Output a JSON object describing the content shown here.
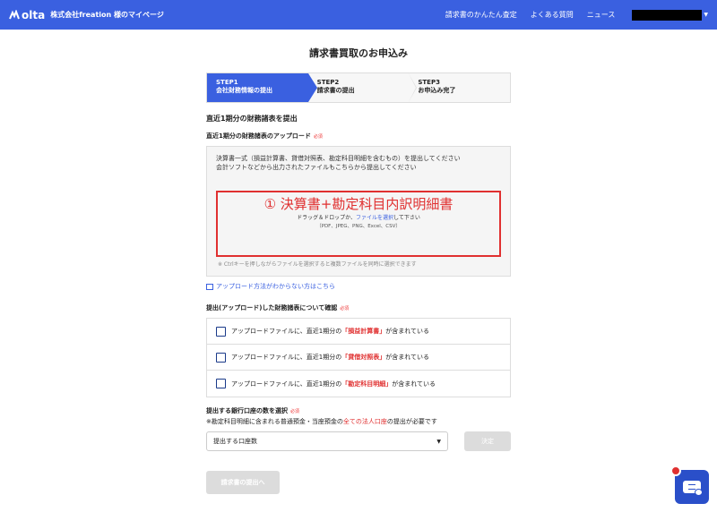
{
  "header": {
    "logo_text": "olta",
    "company": "株式会社freation 様のマイページ",
    "nav": [
      "請求書のかんたん査定",
      "よくある質問",
      "ニュース"
    ]
  },
  "page_title": "請求書買取のお申込み",
  "steps": [
    {
      "num": "STEP1",
      "label": "会社財務情報の提出"
    },
    {
      "num": "STEP2",
      "label": "請求書の提出"
    },
    {
      "num": "STEP3",
      "label": "お申込み完了"
    }
  ],
  "section1_title": "直近1期分の財務諸表を提出",
  "upload": {
    "title": "直近1期分の財務諸表のアップロード",
    "required": "必須",
    "desc": "決算書一式（損益計算書、貸借対照表、勘定科目明細を含むもの）を提出してください",
    "desc2": "会計ソフトなどから出力されたファイルもこちらから提出してください",
    "annotation": "① 決算書+勘定科目内訳明細書",
    "drop_prefix": "ドラッグ＆ドロップか、",
    "drop_link": "ファイルを選択",
    "drop_suffix": "して下さい",
    "formats": "（PDF、JPEG、PNG、Excel、CSV）",
    "note": "※ Ctrlキーを押しながらファイルを選択すると複数ファイルを同時に選択できます"
  },
  "help_link": "アップロード方法がわからない方はこちら",
  "confirm": {
    "title": "提出(アップロード)した財務諸表について確認",
    "required": "必須",
    "items": [
      {
        "prefix": "アップロードファイルに、直近1期分の",
        "hl": "「損益計算書」",
        "suffix": "が含まれている"
      },
      {
        "prefix": "アップロードファイルに、直近1期分の",
        "hl": "「貸借対照表」",
        "suffix": "が含まれている"
      },
      {
        "prefix": "アップロードファイルに、直近1期分の",
        "hl": "「勘定科目明細」",
        "suffix": "が含まれている"
      }
    ]
  },
  "bank": {
    "title": "提出する銀行口座の数を選択",
    "required": "必須",
    "note_prefix": "※勘定科目明細に含まれる普通預金・当座預金の",
    "note_hl": "全ての法人口座",
    "note_suffix": "の提出が必要です",
    "select_value": "提出する口座数",
    "decide_label": "決定"
  },
  "submit_label": "請求書の提出へ",
  "colors": {
    "brand": "#3a60e0",
    "highlight": "#e03030",
    "disabled": "#dcdcdc"
  }
}
